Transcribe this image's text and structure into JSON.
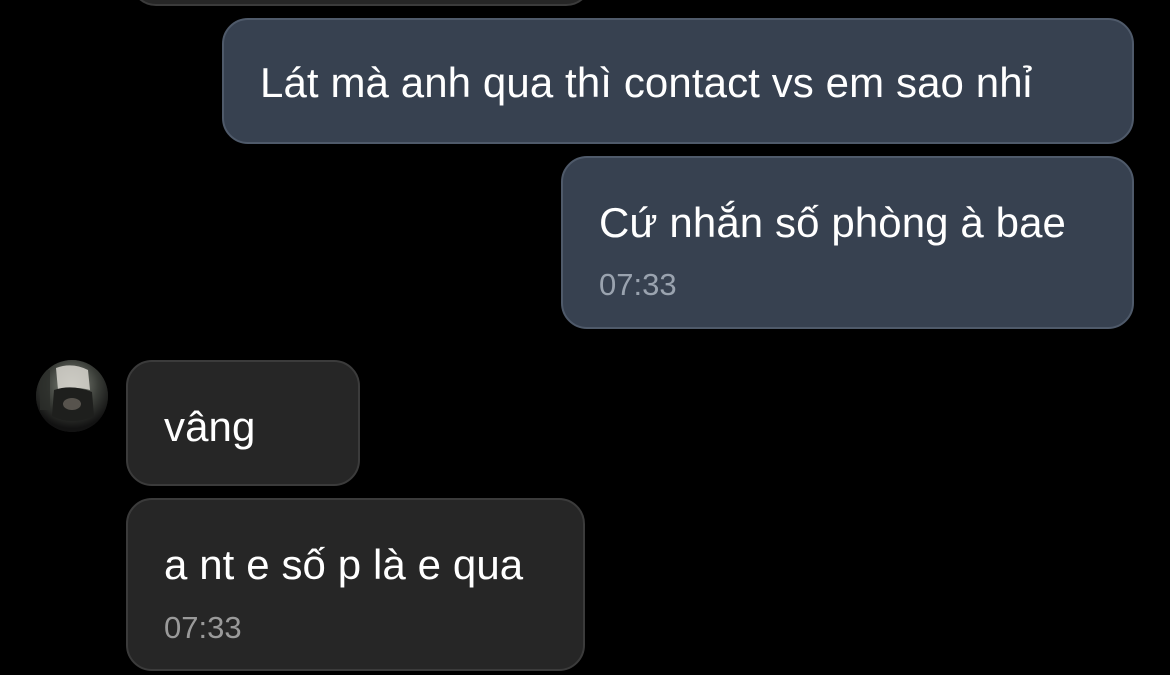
{
  "messages": [
    {
      "direction": "outgoing",
      "text": "Lát mà anh qua thì contact vs em sao nhỉ",
      "time": ""
    },
    {
      "direction": "outgoing",
      "text": "Cứ nhắn số phòng à bae",
      "time": "07:33"
    },
    {
      "direction": "incoming",
      "text": "vâng",
      "time": ""
    },
    {
      "direction": "incoming",
      "text": "a nt e số p là e qua",
      "time": "07:33"
    }
  ],
  "contact": {
    "avatar_icon": "contact-avatar"
  },
  "colors": {
    "background": "#000000",
    "outgoing_bubble": "#374150",
    "incoming_bubble": "#262626",
    "message_text": "#ffffff",
    "timestamp_text": "#9aa3af"
  }
}
